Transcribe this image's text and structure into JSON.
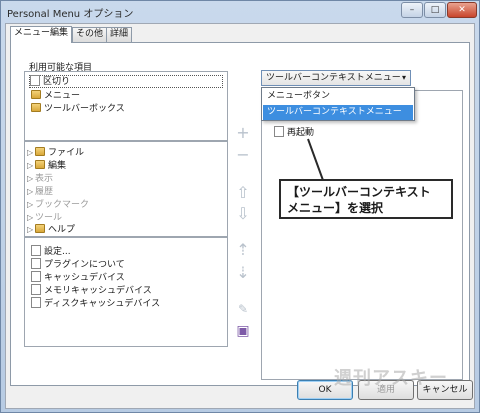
{
  "window": {
    "title": "Personal Menu オプション",
    "min": "–",
    "max": "□",
    "close": "✕"
  },
  "tabs": [
    {
      "label": "メニュー編集"
    },
    {
      "label": "その他"
    },
    {
      "label": "詳細"
    }
  ],
  "available": {
    "label": "利用可能な項目",
    "group1": [
      {
        "label": "区切り",
        "icon": "doc-icon"
      },
      {
        "label": "メニュー",
        "icon": "folder-icon"
      },
      {
        "label": "ツールバーボックス",
        "icon": "folder-icon"
      }
    ],
    "group2": [
      {
        "label": "ファイル",
        "icon": "folder-icon",
        "dim": false
      },
      {
        "label": "編集",
        "icon": "folder-icon",
        "dim": false
      },
      {
        "label": "表示",
        "icon": "none",
        "dim": true
      },
      {
        "label": "履歴",
        "icon": "none",
        "dim": true
      },
      {
        "label": "ブックマーク",
        "icon": "none",
        "dim": true
      },
      {
        "label": "ツール",
        "icon": "none",
        "dim": true
      },
      {
        "label": "ヘルプ",
        "icon": "folder-icon",
        "dim": false
      }
    ],
    "group3": [
      {
        "label": "設定..."
      },
      {
        "label": "プラグインについて"
      },
      {
        "label": "キャッシュデバイス"
      },
      {
        "label": "メモリキャッシュデバイス"
      },
      {
        "label": "ディスクキャッシュデバイス"
      }
    ]
  },
  "combo": {
    "value": "ツールバーコンテキストメニュー",
    "arrow": "▾"
  },
  "dropdown": {
    "options": [
      "メニューボタン",
      "ツールバーコンテキストメニュー"
    ]
  },
  "right_list": {
    "items": [
      "再起動"
    ]
  },
  "callout": {
    "line1": "【ツールバーコンテキスト",
    "line2": "メニュー】を選択"
  },
  "buttons": {
    "ok": "OK",
    "apply": "適用",
    "cancel": "キャンセル"
  },
  "watermark": "週刊アスキー",
  "icons": {
    "add": "+",
    "remove": "−",
    "up": "⇧",
    "down": "⇩",
    "move_up": "⇡",
    "move_down": "⇣",
    "edit": "✎",
    "save": "▣"
  }
}
